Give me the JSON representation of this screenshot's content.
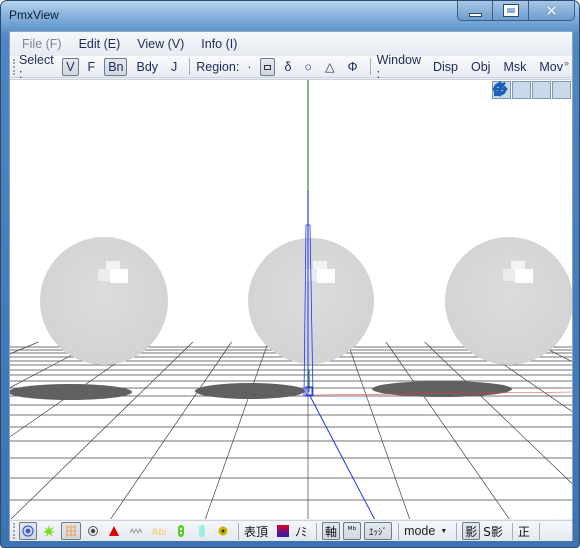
{
  "window": {
    "title": "PmxView",
    "controls": {
      "minimize": "minimize",
      "maximize": "maximize",
      "close": "close"
    }
  },
  "menu": [
    {
      "label": "File (F)",
      "enabled": false
    },
    {
      "label": "Edit (E)",
      "enabled": true
    },
    {
      "label": "View (V)",
      "enabled": true
    },
    {
      "label": "Info (I)",
      "enabled": true
    }
  ],
  "toolbar": {
    "select_label": "Select :",
    "select_items": [
      {
        "label": "V",
        "active": true
      },
      {
        "label": "F",
        "active": false
      },
      {
        "label": "Bn",
        "active": true
      },
      {
        "label": "Bdy",
        "active": false
      },
      {
        "label": "J",
        "active": false
      }
    ],
    "region_label": "Region:",
    "region_items": [
      {
        "label": "·",
        "icon": "point-icon",
        "active": false
      },
      {
        "label": "",
        "icon": "rectangle-icon",
        "active": true
      },
      {
        "label": "δ",
        "icon": "lasso-icon",
        "active": false
      },
      {
        "label": "○",
        "icon": "circle-icon",
        "active": false
      },
      {
        "label": "△",
        "icon": "triangle-icon",
        "active": false
      },
      {
        "label": "Φ",
        "icon": "phi-icon",
        "active": false
      }
    ],
    "window_label": "Window :",
    "window_items": [
      "Disp",
      "Obj",
      "Msk",
      "Mov"
    ],
    "overflow": "»"
  },
  "nav_tools": [
    {
      "icon": "rotate-view-icon"
    },
    {
      "icon": "pan-view-icon"
    },
    {
      "icon": "zoom-view-icon"
    },
    {
      "icon": "reset-rotation-icon"
    }
  ],
  "scene": {
    "objects": [
      "sphere",
      "sphere",
      "sphere"
    ],
    "colors": {
      "sphere": "#d8d8d8",
      "highlight": "#ffffff",
      "shadow": "#606060",
      "grid": "#444444",
      "axis_x": "#e04040",
      "axis_y": "#2f8f2f",
      "axis_z": "#2233ee"
    }
  },
  "statusbar": {
    "icon_buttons": [
      {
        "icon": "vertex-display-icon",
        "active": true,
        "color": "#3b5bdb"
      },
      {
        "icon": "green-splash-icon",
        "active": false,
        "color": "#66dd22"
      },
      {
        "icon": "orange-grid-icon",
        "active": true,
        "color": "#f0a050"
      },
      {
        "icon": "radio-target-icon",
        "active": false,
        "color": "#444444"
      },
      {
        "icon": "red-triangle-icon",
        "active": false,
        "color": "#e00000"
      },
      {
        "icon": "gray-wave-icon",
        "active": false,
        "color": "#888888"
      },
      {
        "icon": "yellow-rbj-icon",
        "active": false,
        "color": "#f5c85a"
      },
      {
        "icon": "green-capsule-icon",
        "active": false,
        "color": "#55cc22"
      },
      {
        "icon": "cyan-capsule-icon",
        "active": false,
        "color": "#99eedd"
      },
      {
        "icon": "yellow-gear-icon",
        "active": false,
        "color": "#c8b400"
      }
    ],
    "face_label": "表頂",
    "color_swatch": {
      "top": "#e00020",
      "bottom": "#2020c0"
    },
    "normal_label": "ﾉﾐ",
    "axis_label": "軸",
    "mb_label": "ᴹᵇ",
    "edge_label": "ｴｯｼﾞ",
    "mode_label": "mode",
    "shadow_label": "影",
    "sshadow_label": "S影",
    "ortho_label": "正"
  }
}
